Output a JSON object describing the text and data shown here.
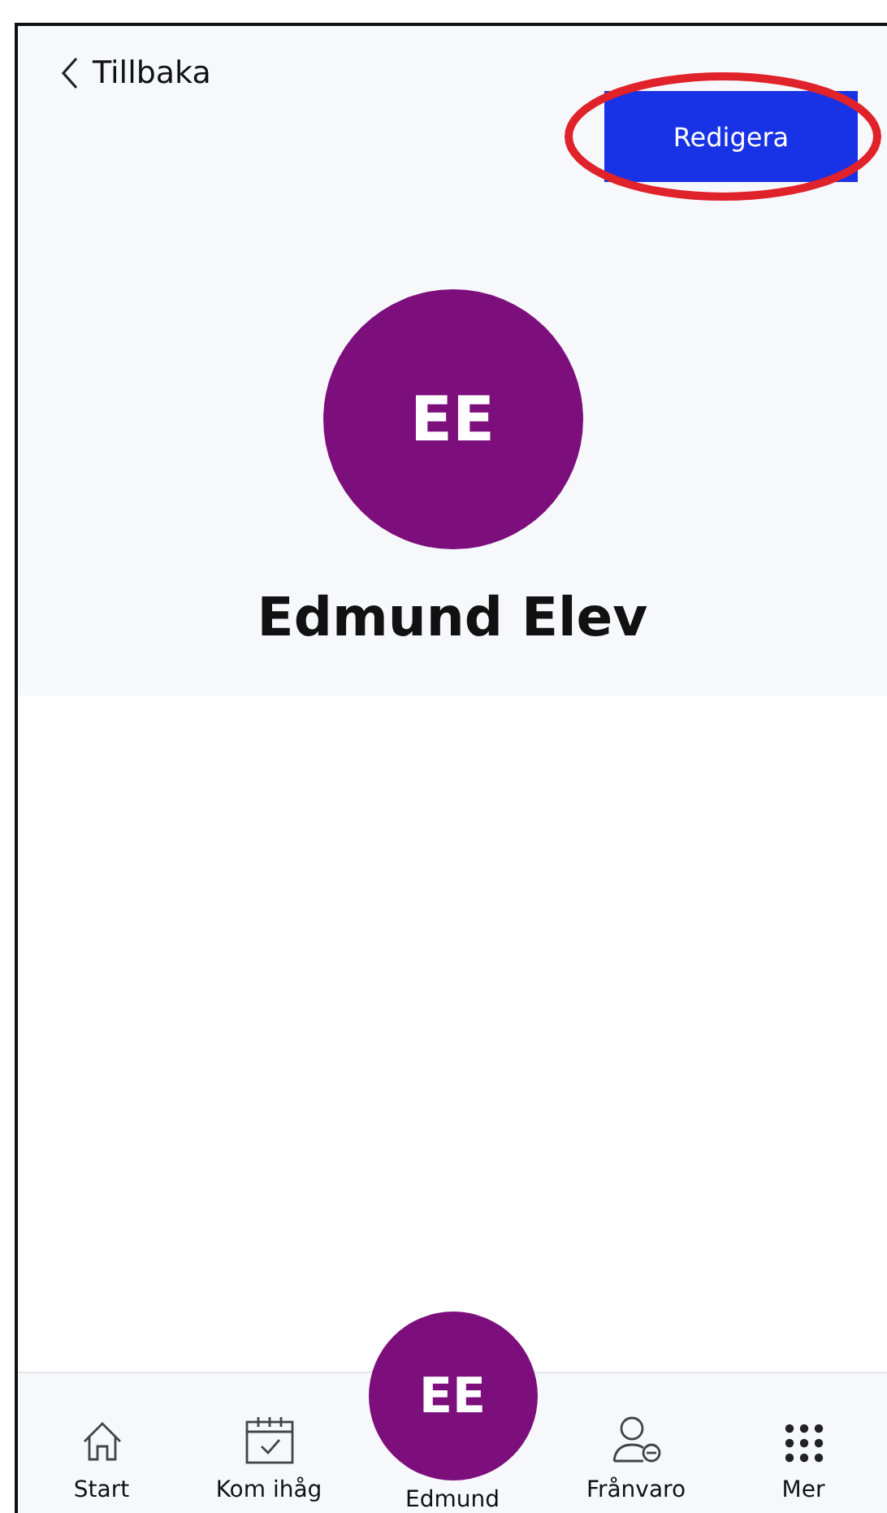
{
  "header": {
    "back_label": "Tillbaka",
    "edit_button": "Redigera",
    "highlighted": true
  },
  "profile": {
    "initials": "EE",
    "name": "Edmund Elev"
  },
  "nav": [
    {
      "kind": "home",
      "label": "Start"
    },
    {
      "kind": "calendar",
      "label": "Kom ihåg"
    },
    {
      "kind": "avatar",
      "initials": "EE",
      "label": "Edmund"
    },
    {
      "kind": "absence",
      "label": "Frånvaro"
    },
    {
      "kind": "more",
      "label": "Mer"
    }
  ]
}
